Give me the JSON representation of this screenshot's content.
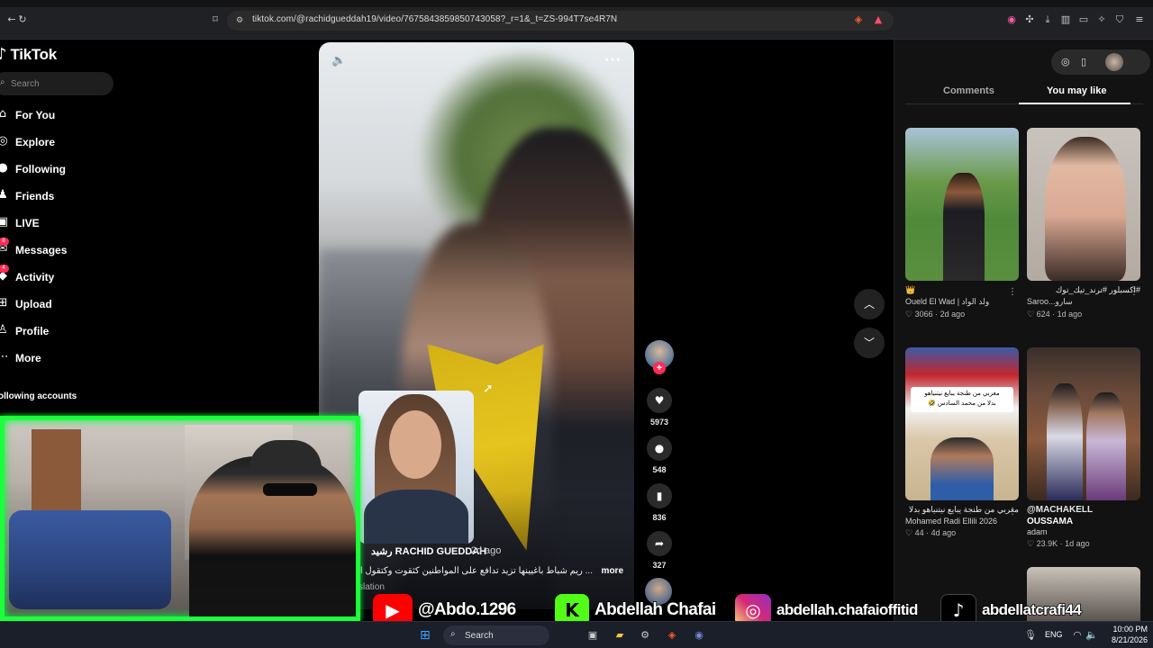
{
  "browser": {
    "url": "tiktok.com/@rachidgueddah19/video/7675843859850743058?_r=1&_t=ZS-994T7se4R7N"
  },
  "sidebar": {
    "logo": "TikTok",
    "search_placeholder": "Search",
    "items": [
      {
        "label": "For You",
        "icon": "home-icon",
        "glyph": "⌂"
      },
      {
        "label": "Explore",
        "icon": "compass-icon",
        "glyph": "◎"
      },
      {
        "label": "Following",
        "icon": "following-icon",
        "glyph": "●"
      },
      {
        "label": "Friends",
        "icon": "friends-icon",
        "glyph": "♟"
      },
      {
        "label": "LIVE",
        "icon": "live-icon",
        "glyph": "▣"
      },
      {
        "label": "Messages",
        "icon": "messages-icon",
        "glyph": "✉",
        "badge": "8"
      },
      {
        "label": "Activity",
        "icon": "activity-icon",
        "glyph": "◆",
        "badge": "4"
      },
      {
        "label": "Upload",
        "icon": "upload-icon",
        "glyph": "⊞"
      },
      {
        "label": "Profile",
        "icon": "profile-icon",
        "glyph": "♙"
      },
      {
        "label": "More",
        "icon": "more-icon",
        "glyph": "⋯"
      }
    ],
    "following_accounts_label": "ollowing accounts"
  },
  "video": {
    "author": "رشيد RACHID GUEDDAH",
    "age": "· 2d ago",
    "caption": "... ريم شباط باغيينها تزيد تدافع على المواطنين كثقوت وكتقول الـ",
    "caption_more": "more",
    "caption_sub": "slation"
  },
  "actions": {
    "likes": "5973",
    "comments": "548",
    "saves": "836",
    "shares": "327"
  },
  "right_panel": {
    "tabs": [
      "Comments",
      "You may like"
    ],
    "active_tab": "You may like",
    "cards": [
      {
        "line1": "👑",
        "line2": "Oueld El Wad | ولد الواد",
        "likes": "♡ 3066",
        "age": "2d ago"
      },
      {
        "line1": "#اكسبلور #ترند_تيك_توك",
        "line2": "Saroo...سارو",
        "likes": "♡ 624",
        "age": "1d ago"
      },
      {
        "line1": "مغربي من طنجة يبايع نيتنياهو بدلا",
        "line2": "Mohamed Radi Ellili 2026",
        "likes": "♡ 44",
        "age": "4d ago"
      },
      {
        "line1": "@MACHAKELL",
        "line2": "OUSSAMA",
        "line3": "adam",
        "likes": "♡ 23.9K",
        "age": "1d ago"
      }
    ],
    "card3_overlay1": "مغربي من طنجة يبايع نيتنياهو",
    "card3_overlay2": "بدلا من محمد السادس 🤣"
  },
  "social": {
    "youtube": "@Abdo.1296",
    "kick": "Abdellah Chafai",
    "instagram": "abdellah.chafaioffitid",
    "tiktok": "abdellatcrafi44"
  },
  "taskbar": {
    "search_label": "Search",
    "lang": "ENG",
    "time": "10:00 PM",
    "date": "8/21/2026"
  },
  "colors": {
    "accent_pink": "#fe2c55",
    "webcam_border": "#1dff3a",
    "youtube_red": "#ff0000",
    "kick_green": "#53fc18"
  }
}
